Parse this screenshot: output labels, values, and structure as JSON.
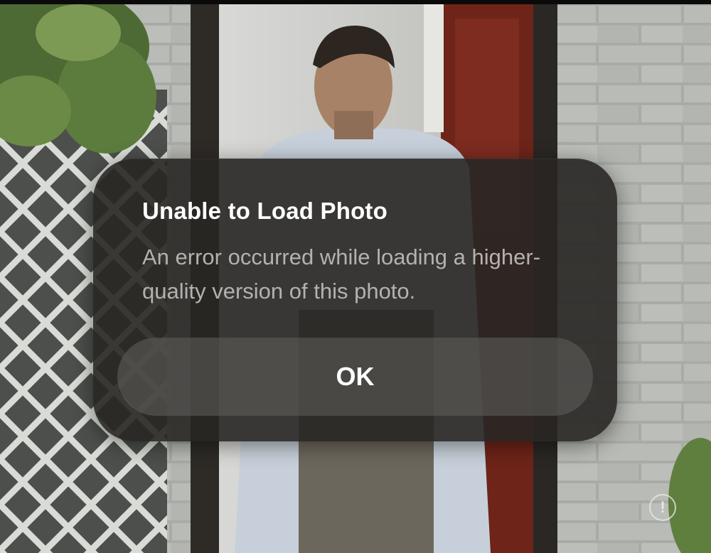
{
  "alert": {
    "title": "Unable to Load Photo",
    "message": "An error occurred while loading a higher-quality version of this photo.",
    "ok_label": "OK"
  },
  "info_button": {
    "icon": "exclamation-circle-icon",
    "glyph": "!"
  },
  "colors": {
    "alert_background": "#282624",
    "title_text": "#ffffff",
    "message_text": "#b4b2ae",
    "button_background": "#5c5a57"
  }
}
